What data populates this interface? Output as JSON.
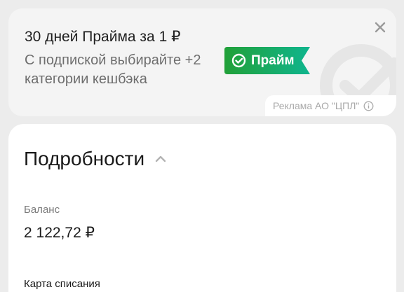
{
  "promo": {
    "title": "30 дней Прайма за 1 ₽",
    "subtitle": "С подпиской выбирайте +2 категории кешбэка",
    "badge_label": "Прайм",
    "ad_disclaimer": "Реклама АО \"ЦПЛ\"",
    "close_icon": "close-icon",
    "info_icon": "info-icon",
    "colors": {
      "badge_green": "#21a038",
      "badge_teal": "#0fb58e"
    }
  },
  "details": {
    "title": "Подробности",
    "collapse_icon": "chevron-up-icon",
    "fields": [
      {
        "label": "Баланс",
        "value": "2 122,72 ₽"
      },
      {
        "label": "Карта списания"
      }
    ]
  }
}
